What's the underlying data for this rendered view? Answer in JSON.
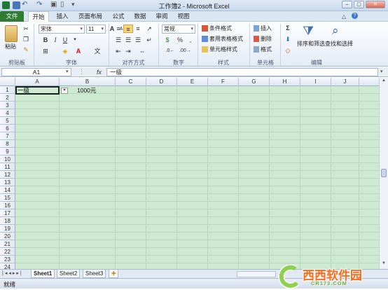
{
  "window": {
    "title": "工作簿2 - Microsoft Excel"
  },
  "tabs": [
    "文件",
    "开始",
    "插入",
    "页面布局",
    "公式",
    "数据",
    "审阅",
    "视图"
  ],
  "ribbon": {
    "clipboard": {
      "paste": "粘贴",
      "label": "剪贴板"
    },
    "font": {
      "name": "宋体",
      "size": "11",
      "bold": "B",
      "italic": "I",
      "underline": "U",
      "grow": "A",
      "shrink": "A",
      "label": "字体"
    },
    "alignment": {
      "label": "对齐方式"
    },
    "number": {
      "format": "常规",
      "label": "数字"
    },
    "styles": {
      "conditional": "条件格式",
      "table": "套用表格格式",
      "cell": "单元格样式",
      "label": "样式"
    },
    "cells": {
      "insert": "插入",
      "delete": "删除",
      "format": "格式",
      "label": "单元格"
    },
    "editing": {
      "sort": "排序和筛选",
      "find": "查找和选择",
      "label": "编辑"
    }
  },
  "formula_bar": {
    "name_box": "A1",
    "fx": "fx",
    "formula": "一级"
  },
  "columns": [
    "A",
    "B",
    "C",
    "D",
    "E",
    "F",
    "G",
    "H",
    "I",
    "J"
  ],
  "rows": [
    "1",
    "2",
    "3",
    "4",
    "5",
    "6",
    "7",
    "8",
    "9",
    "10",
    "11",
    "12",
    "13",
    "14",
    "15",
    "16",
    "17",
    "18",
    "19",
    "20",
    "21",
    "22",
    "23",
    "24"
  ],
  "cells": {
    "A1": "一级",
    "B1": "1000元"
  },
  "sheets": [
    "Sheet1",
    "Sheet2",
    "Sheet3"
  ],
  "status": "就绪",
  "watermark": {
    "brand": "西西软件园",
    "url": "CR173.COM"
  }
}
